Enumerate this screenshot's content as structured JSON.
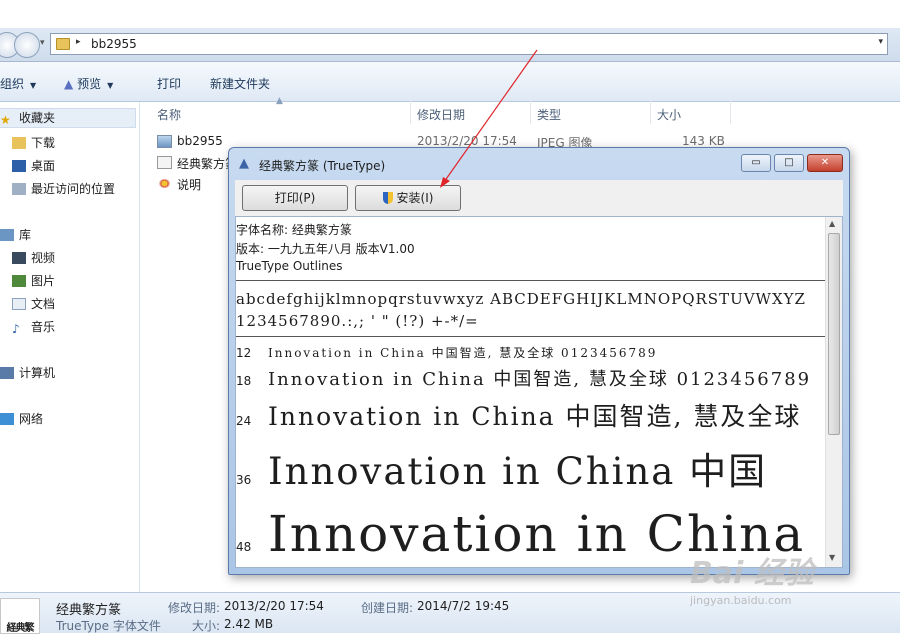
{
  "address": {
    "path": "bb2955"
  },
  "toolbar": {
    "organize": "组织",
    "preview": "预览",
    "print": "打印",
    "new_folder": "新建文件夹"
  },
  "nav": {
    "favorites": "收藏夹",
    "downloads": "下载",
    "desktop": "桌面",
    "recent": "最近访问的位置",
    "libraries": "库",
    "videos": "视频",
    "pictures": "图片",
    "documents": "文档",
    "music": "音乐",
    "computer": "计算机",
    "network": "网络"
  },
  "columns": {
    "name": "名称",
    "date": "修改日期",
    "type": "类型",
    "size": "大小"
  },
  "files": [
    {
      "name": "bb2955",
      "date": "2013/2/20 17:54",
      "type": "JPEG 图像",
      "size": "143 KB"
    },
    {
      "name": "经典繁方篆",
      "date": "",
      "type": "",
      "size": ""
    },
    {
      "name": "说明",
      "date": "",
      "type": "",
      "size": ""
    }
  ],
  "details": {
    "thumb_text": "経典繁",
    "name": "经典繁方篆",
    "type": "TrueType 字体文件",
    "modified_label": "修改日期:",
    "modified": "2013/2/20 17:54",
    "created_label": "创建日期:",
    "created": "2014/7/2 19:45",
    "size_label": "大小:",
    "size": "2.42 MB"
  },
  "font_window": {
    "title": "经典繁方篆 (TrueType)",
    "min_glyph": "▭",
    "max_glyph": "□",
    "close_glyph": "✕",
    "print_button": "打印(P)",
    "install_button": "安装(I)",
    "font_name": "字体名称: 经典繁方篆",
    "version": "版本: 一九九五年八月 版本V1.00",
    "outline": "TrueType Outlines",
    "charset_lower": "abcdefghijklmnopqrstuvwxyz ABCDEFGHIJKLMNOPQRSTUVWXYZ",
    "charset_digits": "1234567890.:,; ' \" (!?) +-*/=",
    "samples": [
      {
        "size": "12",
        "text": "Innovation in China 中国智造, 慧及全球 0123456789"
      },
      {
        "size": "18",
        "text": "Innovation in China 中国智造, 慧及全球 0123456789"
      },
      {
        "size": "24",
        "text": "Innovation in China 中国智造, 慧及全球"
      },
      {
        "size": "36",
        "text": "Innovation in China 中国"
      },
      {
        "size": "48",
        "text": "Innovation in China"
      }
    ]
  },
  "watermark": {
    "brand": "Bai 经验",
    "url": "jingyan.baidu.com"
  },
  "colors": {
    "annotation_arrow": "#e0252b",
    "accent": "#3b63a8"
  }
}
